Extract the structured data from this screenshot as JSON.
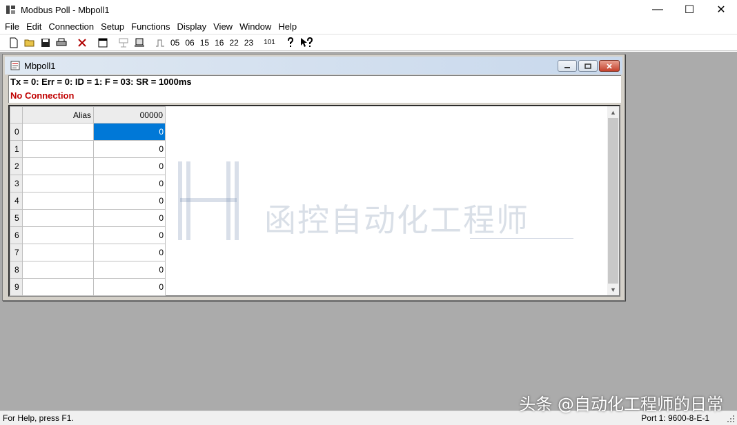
{
  "window": {
    "title": "Modbus Poll - Mbpoll1",
    "minimize": "—",
    "maximize": "☐",
    "close": "✕"
  },
  "menu": [
    "File",
    "Edit",
    "Connection",
    "Setup",
    "Functions",
    "Display",
    "View",
    "Window",
    "Help"
  ],
  "toolbar": {
    "codes": [
      "05",
      "06",
      "15",
      "16",
      "22",
      "23"
    ],
    "code_101": "101"
  },
  "child": {
    "title": "Mbpoll1",
    "status_line": "Tx = 0: Err = 0: ID = 1: F = 03: SR = 1000ms",
    "connection_status": "No Connection",
    "grid": {
      "headers": [
        "",
        "Alias",
        "00000"
      ],
      "rows": [
        {
          "index": "0",
          "alias": "",
          "value": "0"
        },
        {
          "index": "1",
          "alias": "",
          "value": "0"
        },
        {
          "index": "2",
          "alias": "",
          "value": "0"
        },
        {
          "index": "3",
          "alias": "",
          "value": "0"
        },
        {
          "index": "4",
          "alias": "",
          "value": "0"
        },
        {
          "index": "5",
          "alias": "",
          "value": "0"
        },
        {
          "index": "6",
          "alias": "",
          "value": "0"
        },
        {
          "index": "7",
          "alias": "",
          "value": "0"
        },
        {
          "index": "8",
          "alias": "",
          "value": "0"
        },
        {
          "index": "9",
          "alias": "",
          "value": "0"
        }
      ]
    }
  },
  "watermark": {
    "center_text": "函控自动化工程师",
    "corner_text": "头条 @自动化工程师的日常"
  },
  "statusbar": {
    "help": "For Help, press F1.",
    "port": "Port 1: 9600-8-E-1"
  },
  "colors": {
    "selection": "#0078d7",
    "error_text": "#c00000",
    "mdi_background": "#ababab"
  }
}
